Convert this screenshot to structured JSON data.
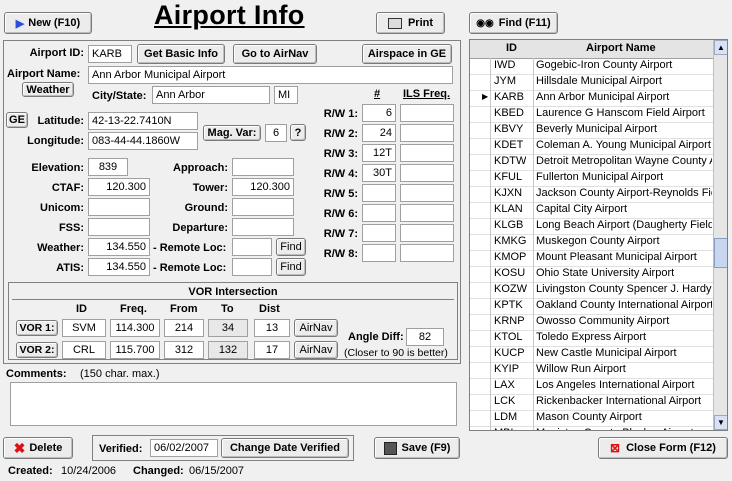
{
  "toolbar": {
    "new_label": "New  (F10)",
    "print_label": "Print",
    "find_label": "Find  (F11)",
    "title": "Airport Info"
  },
  "form": {
    "airport_id_label": "Airport ID:",
    "airport_id": "KARB",
    "get_basic_info": "Get Basic Info",
    "go_to_airnav": "Go to AirNav",
    "airspace_ge": "Airspace in GE",
    "airport_name_label": "Airport Name:",
    "airport_name": "Ann Arbor Municipal Airport",
    "weather_btn": "Weather",
    "city_state_label": "City/State:",
    "city": "Ann Arbor",
    "state": "MI",
    "ge_btn": "GE",
    "latitude_label": "Latitude:",
    "latitude": "42-13-22.7410N",
    "longitude_label": "Longitude:",
    "longitude": "083-44-44.1860W",
    "mag_var_label": "Mag. Var:",
    "mag_var": "6",
    "help_btn": "?",
    "elevation_label": "Elevation:",
    "elevation": "839",
    "approach_label": "Approach:",
    "approach": "",
    "ctaf_label": "CTAF:",
    "ctaf": "120.300",
    "tower_label": "Tower:",
    "tower": "120.300",
    "unicom_label": "Unicom:",
    "unicom": "",
    "ground_label": "Ground:",
    "ground": "",
    "fss_label": "FSS:",
    "fss": "",
    "departure_label": "Departure:",
    "departure": "",
    "weather_label": "Weather:",
    "weather": "134.550",
    "remote_loc_label": "- Remote Loc:",
    "weather_remote": "",
    "find_btn": "Find",
    "atis_label": "ATIS:",
    "atis": "134.550",
    "atis_remote": "",
    "runway_num_header": "#",
    "ils_header": "ILS Freq.",
    "runways": [
      {
        "label": "R/W 1:",
        "num": "6",
        "ils": ""
      },
      {
        "label": "R/W 2:",
        "num": "24",
        "ils": ""
      },
      {
        "label": "R/W 3:",
        "num": "12T",
        "ils": ""
      },
      {
        "label": "R/W 4:",
        "num": "30T",
        "ils": ""
      },
      {
        "label": "R/W 5:",
        "num": "",
        "ils": ""
      },
      {
        "label": "R/W 6:",
        "num": "",
        "ils": ""
      },
      {
        "label": "R/W 7:",
        "num": "",
        "ils": ""
      },
      {
        "label": "R/W 8:",
        "num": "",
        "ils": ""
      }
    ]
  },
  "vor": {
    "title": "VOR Intersection",
    "headers": {
      "id": "ID",
      "freq": "Freq.",
      "from": "From",
      "to": "To",
      "dist": "Dist"
    },
    "rows": [
      {
        "btn": "VOR 1:",
        "id": "SVM",
        "freq": "114.300",
        "from": "214",
        "to": "34",
        "dist": "13",
        "airnav": "AirNav"
      },
      {
        "btn": "VOR 2:",
        "id": "CRL",
        "freq": "115.700",
        "from": "312",
        "to": "132",
        "dist": "17",
        "airnav": "AirNav"
      }
    ],
    "angle_diff_label": "Angle Diff:",
    "angle_diff": "82",
    "angle_note": "(Closer to 90 is better)"
  },
  "comments": {
    "label": "Comments:",
    "hint": "(150 char. max.)",
    "value": ""
  },
  "footer": {
    "delete_label": "Delete",
    "verified_label": "Verified:",
    "verified_date": "06/02/2007",
    "change_date_label": "Change Date Verified",
    "save_label": "Save  (F9)",
    "close_label": "Close Form  (F12)",
    "created_label": "Created:",
    "created": "10/24/2006",
    "changed_label": "Changed:",
    "changed": "06/15/2007"
  },
  "list": {
    "col_id": "ID",
    "col_name": "Airport Name",
    "selected_index": 3,
    "rows": [
      {
        "id": "IWD",
        "name": "Gogebic-Iron County Airport"
      },
      {
        "id": "JYM",
        "name": "Hillsdale Municipal Airport"
      },
      {
        "id": "KARB",
        "name": "Ann Arbor Municipal Airport"
      },
      {
        "id": "KBED",
        "name": "Laurence G Hanscom Field Airport"
      },
      {
        "id": "KBVY",
        "name": "Beverly Municipal Airport"
      },
      {
        "id": "KDET",
        "name": "Coleman A. Young Municipal Airport"
      },
      {
        "id": "KDTW",
        "name": "Detroit Metropolitan Wayne County Ai"
      },
      {
        "id": "KFUL",
        "name": "Fullerton Municipal Airport"
      },
      {
        "id": "KJXN",
        "name": "Jackson County Airport-Reynolds Field"
      },
      {
        "id": "KLAN",
        "name": "Capital City Airport"
      },
      {
        "id": "KLGB",
        "name": "Long Beach Airport (Daugherty Field)"
      },
      {
        "id": "KMKG",
        "name": "Muskegon County Airport"
      },
      {
        "id": "KMOP",
        "name": "Mount Pleasant Municipal Airport"
      },
      {
        "id": "KOSU",
        "name": "Ohio State University Airport"
      },
      {
        "id": "KOZW",
        "name": "Livingston County Spencer J. Hardy A"
      },
      {
        "id": "KPTK",
        "name": "Oakland County International Airport"
      },
      {
        "id": "KRNP",
        "name": "Owosso Community Airport"
      },
      {
        "id": "KTOL",
        "name": "Toledo Express Airport"
      },
      {
        "id": "KUCP",
        "name": "New Castle Municipal Airport"
      },
      {
        "id": "KYIP",
        "name": "Willow Run Airport"
      },
      {
        "id": "LAX",
        "name": "Los Angeles International Airport"
      },
      {
        "id": "LCK",
        "name": "Rickenbacker International Airport"
      },
      {
        "id": "LDM",
        "name": "Mason County Airport"
      },
      {
        "id": "MBL",
        "name": "Manistee County-Blacker Airport"
      }
    ]
  }
}
